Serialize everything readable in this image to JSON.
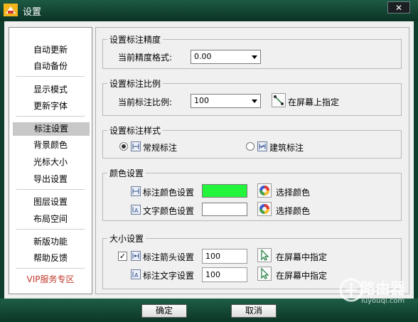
{
  "window": {
    "title": "设置",
    "close_glyph": "✕"
  },
  "sidebar": {
    "items": [
      {
        "label": "自动更新"
      },
      {
        "label": "自动备份"
      },
      {
        "label": "显示模式"
      },
      {
        "label": "更新字体"
      },
      {
        "label": "标注设置",
        "selected": true
      },
      {
        "label": "背景颜色"
      },
      {
        "label": "光标大小"
      },
      {
        "label": "导出设置"
      },
      {
        "label": "图层设置"
      },
      {
        "label": "布局空间"
      },
      {
        "label": "新版功能"
      },
      {
        "label": "帮助反馈"
      },
      {
        "label": "VIP服务专区",
        "vip": true
      }
    ]
  },
  "precision": {
    "title": "设置标注精度",
    "format_label": "当前精度格式:",
    "format_value": "0.00"
  },
  "scale": {
    "title": "设置标注比例",
    "label": "当前标注比例:",
    "value": "100",
    "screen_label": "在屏幕上指定"
  },
  "style": {
    "title": "设置标注样式",
    "options": [
      {
        "label": "常规标注",
        "selected": true
      },
      {
        "label": "建筑标注",
        "selected": false
      }
    ]
  },
  "color": {
    "title": "颜色设置",
    "dim_color_label": "标注颜色设置",
    "dim_color": "#22f53c",
    "text_color_label": "文字颜色设置",
    "text_color": "#ffffff",
    "choose_label": "选择颜色"
  },
  "size": {
    "title": "大小设置",
    "arrow_label": "标注箭头设置",
    "arrow_checked": true,
    "arrow_value": "100",
    "text_label": "标注文字设置",
    "text_value": "100",
    "screen_label": "在屏幕中指定"
  },
  "footer": {
    "ok_label": "确定",
    "cancel_label": "取消"
  },
  "watermark": {
    "brand": "路由器",
    "url": "luyouqi.com"
  }
}
